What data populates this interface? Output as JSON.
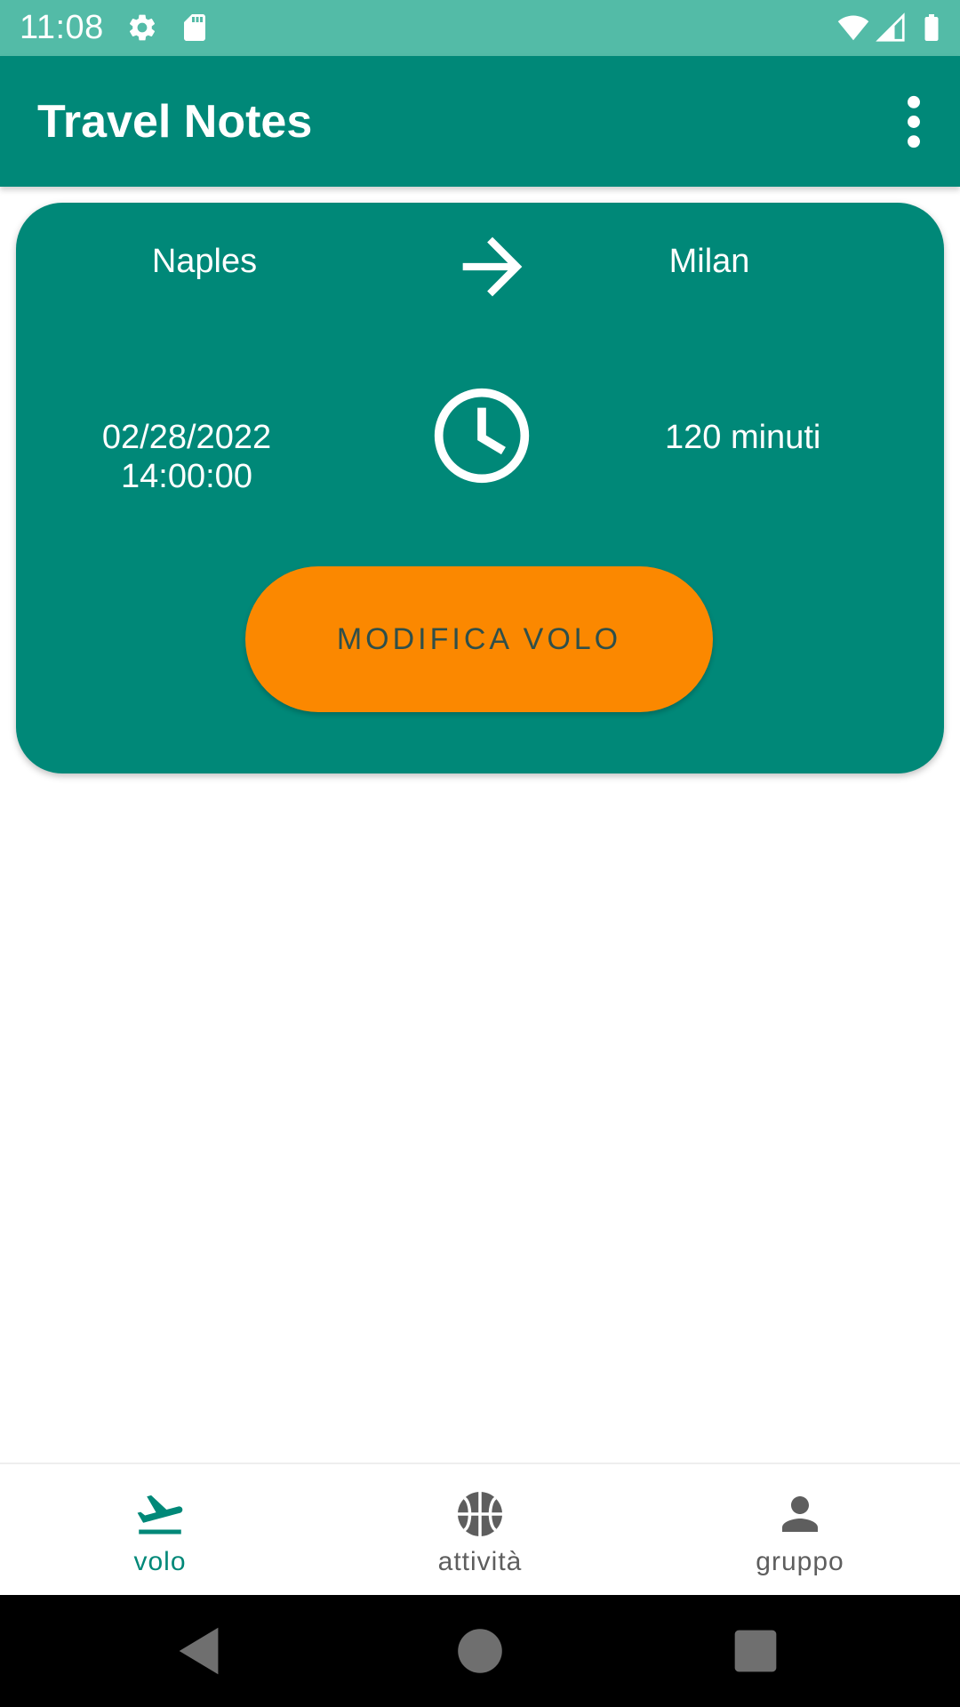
{
  "status_bar": {
    "time": "11:08",
    "left_icons": [
      "gear-icon",
      "sd-card-icon"
    ],
    "right_icons": [
      "wifi-icon",
      "cellular-signal-icon",
      "battery-icon"
    ],
    "background": "#53BBA7"
  },
  "app_bar": {
    "title": "Travel Notes",
    "menu_icon": "more-vert-icon",
    "background": "#008878"
  },
  "flight": {
    "origin": "Naples",
    "destination": "Milan",
    "departure_date": "02/28/2022",
    "departure_time": "14:00:00",
    "duration": "120 minuti",
    "route_icon": "arrow-right-icon",
    "time_icon": "clock-icon",
    "edit_button_label": "MODIFICA VOLO",
    "card_color": "#008878",
    "button_color": "#FB8800"
  },
  "bottom_nav": {
    "items": [
      {
        "label": "volo",
        "icon": "flight-takeoff-icon",
        "active": true
      },
      {
        "label": "attività",
        "icon": "sports-basketball-icon",
        "active": false
      },
      {
        "label": "gruppo",
        "icon": "person-icon",
        "active": false
      }
    ],
    "active_color": "#008878",
    "inactive_color": "#5E5E5E"
  },
  "system_nav": {
    "icons": [
      "back-icon",
      "home-icon",
      "recents-icon"
    ]
  }
}
